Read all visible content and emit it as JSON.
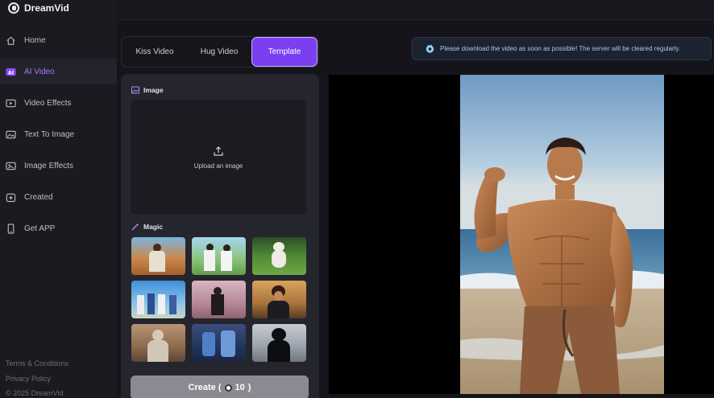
{
  "app": {
    "name": "DreamVid"
  },
  "sidebar": {
    "items": [
      {
        "label": "Home",
        "icon": "home-icon",
        "active": false
      },
      {
        "label": "AI Video",
        "icon": "ai-video-icon",
        "active": true
      },
      {
        "label": "Video Effects",
        "icon": "video-effects-icon",
        "active": false
      },
      {
        "label": "Text To Image",
        "icon": "text-to-image-icon",
        "active": false
      },
      {
        "label": "Image Effects",
        "icon": "image-effects-icon",
        "active": false
      },
      {
        "label": "Created",
        "icon": "created-icon",
        "active": false
      },
      {
        "label": "Get APP",
        "icon": "phone-icon",
        "active": false
      }
    ],
    "footer": {
      "terms": "Terms & Conditions",
      "privacy": "Privacy Policy",
      "copyright": "© 2025 DreamVid"
    }
  },
  "tabs": [
    {
      "label": "Kiss Video",
      "active": false
    },
    {
      "label": "Hug Video",
      "active": false
    },
    {
      "label": "Template",
      "active": true
    }
  ],
  "image_section": {
    "title": "Image",
    "upload_label": "Upload an image"
  },
  "magic_section": {
    "title": "Magic",
    "templates": [
      "template-1",
      "template-2",
      "template-3",
      "template-4",
      "template-5",
      "template-6",
      "template-7",
      "template-8",
      "template-9"
    ]
  },
  "create_button": {
    "label": "Create (",
    "credits": "10",
    "suffix": ")"
  },
  "notice": {
    "text": "Please download the video as soon as possible! The server will be cleared regularly."
  },
  "colors": {
    "accent": "#7b3ff2",
    "active_text": "#a879ff",
    "panel": "#25252e",
    "background": "#14141a"
  }
}
